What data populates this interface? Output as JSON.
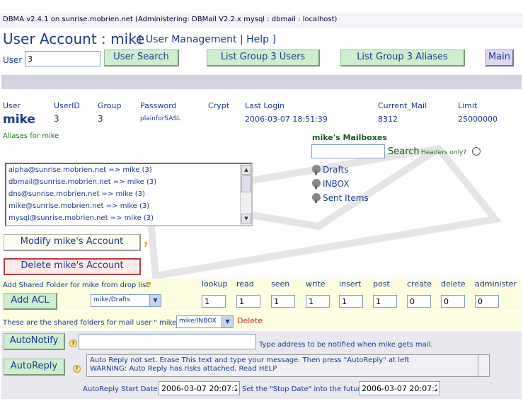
{
  "topbar": {
    "text": "DBMA v2.4.1 on sunrise.mobrien.net (Administering: DBMail V2.2.x mysql : dbmail : localhost)"
  },
  "title": {
    "main": "User Account : mike",
    "links_open": "[",
    "user_management": "User Management",
    "sep": "|",
    "help": "Help",
    "links_close": "]"
  },
  "search": {
    "label": "User",
    "value": "3",
    "user_search": "User Search",
    "list_group_users": "List Group 3 Users",
    "list_group_aliases": "List Group 3 Aliases",
    "main": "Main"
  },
  "account": {
    "headers": [
      "User",
      "UserID",
      "Group",
      "Password",
      "Crypt",
      "Last Login",
      "Current_Mail",
      "Limit"
    ],
    "user": "mike",
    "userid": "3",
    "group": "3",
    "password": "plainforSASL",
    "crypt": "",
    "last_login": "2006-03-07 18:51:39",
    "current_mail": "8312",
    "limit": "25000000"
  },
  "aliases": {
    "title": "Aliases for mike",
    "items": [
      "alpha@sunrise.mobrien.net => mike (3)",
      "dbmail@sunrise.mobrien.net => mike (3)",
      "dns@sunrise.mobrien.net => mike (3)",
      "mike@sunrise.mobrien.net => mike (3)",
      "mysql@sunrise.mobrien.net => mike (3)"
    ]
  },
  "mailboxes": {
    "title": "mike's Mailboxes",
    "search_value": "",
    "search_label": "Search",
    "headers_only": "Headers only?",
    "folders": [
      "Drafts",
      "INBOX",
      "Sent Items"
    ]
  },
  "actions": {
    "modify": "Modify mike's Account",
    "delete": "Delete mike's Account"
  },
  "acl": {
    "title": "Add Shared Folder for mike from drop list",
    "add_button": "Add ACL",
    "folder_selected": "mike/Drafts",
    "columns": [
      {
        "name": "lookup",
        "value": "1"
      },
      {
        "name": "read",
        "value": "1"
      },
      {
        "name": "seen",
        "value": "1"
      },
      {
        "name": "write",
        "value": "1"
      },
      {
        "name": "insert",
        "value": "1"
      },
      {
        "name": "post",
        "value": "1"
      },
      {
        "name": "create",
        "value": "0"
      },
      {
        "name": "delete",
        "value": "0"
      },
      {
        "name": "administer",
        "value": "0"
      }
    ]
  },
  "shared": {
    "text": "These are the shared folders for mail user \" mike \":",
    "selected": "mike/INBOX",
    "delete": "Delete"
  },
  "autonotify": {
    "button": "AutoNotify",
    "value": "",
    "hint": "Type address to be notified when mike gets mail."
  },
  "autoreply": {
    "button": "AutoReply",
    "message_line1": "Auto Reply not set. Erase This text and type your message. Then press \"AutoReply\" at left",
    "message_line2": "WARNING: Auto Reply has risks attached. Read HELP",
    "start_label": "AutoReply Start Date :",
    "start_value": "2006-03-07 20:07:28",
    "stop_label": "Set the \"Stop Date\" into the future:",
    "stop_value": "2006-03-07 20:07:28"
  }
}
